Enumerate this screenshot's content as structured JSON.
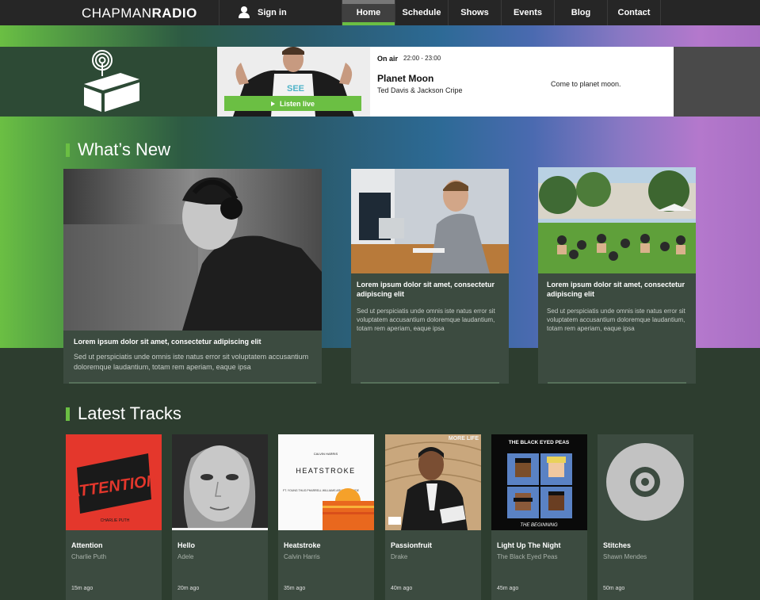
{
  "nav": {
    "logo_light": "CHAPMAN",
    "logo_bold": "RADIO",
    "signin_label": "Sign in",
    "signin_icon": "user-icon",
    "links": [
      "Home",
      "Schedule",
      "Shows",
      "Events",
      "Blog",
      "Contact"
    ],
    "active": "Home"
  },
  "player": {
    "onair_label": "On air",
    "time": "22:00 - 23:00",
    "show_title": "Planet Moon",
    "hosts": "Ted Davis & Jackson Cripe",
    "description": "Come to planet moon.",
    "listen_label": "Listen live"
  },
  "whats_new": {
    "heading": "What’s New",
    "cards": [
      {
        "title": "Lorem ipsum dolor sit amet, consectetur adipiscing elit",
        "text": "Sed ut perspiciatis unde omnis iste natus error sit voluptatem accusantium doloremque laudantium, totam rem aperiam, eaque ipsa"
      },
      {
        "title": "Lorem ipsum dolor sit amet, consectetur adipiscing elit",
        "text": "Sed ut perspiciatis unde omnis iste natus error sit voluptatem accusantium doloremque laudantium, totam rem aperiam, eaque ipsa"
      },
      {
        "title": "Lorem ipsum dolor sit amet, consectetur adipiscing elit",
        "text": "Sed ut perspiciatis unde omnis iste natus error sit voluptatem accusantium doloremque laudantium, totam rem aperiam, eaque ipsa"
      }
    ]
  },
  "latest_tracks": {
    "heading": "Latest Tracks",
    "tracks": [
      {
        "title": "Attention",
        "artist": "Charlie Puth",
        "time": "15m ago",
        "art_text": "ATTENTION",
        "art_sub": "CHARLIE PUTH"
      },
      {
        "title": "Hello",
        "artist": "Adele",
        "time": "20m ago"
      },
      {
        "title": "Heatstroke",
        "artist": "Calvin Harris",
        "time": "35m ago",
        "art_top": "CALVIN HARRIS",
        "art_text": "HEATSTROKE",
        "art_sub": "FT. YOUNG THUG PHARRELL WILLIAMS ARIANA GRANDE"
      },
      {
        "title": "Passionfruit",
        "artist": "Drake",
        "time": "40m ago",
        "art_text": "MORE LIFE"
      },
      {
        "title": "Light Up The Night",
        "artist": "The Black Eyed Peas",
        "time": "45m ago",
        "art_top": "THE BLACK EYED PEAS",
        "art_text": "THE BEGINNING"
      },
      {
        "title": "Stitches",
        "artist": "Shawn Mendes",
        "time": "50m ago"
      }
    ]
  },
  "colors": {
    "accent": "#6bbf43",
    "nav_bg": "#262626",
    "page_bg": "#2d3d2f",
    "card_bg": "#3c4b40"
  }
}
